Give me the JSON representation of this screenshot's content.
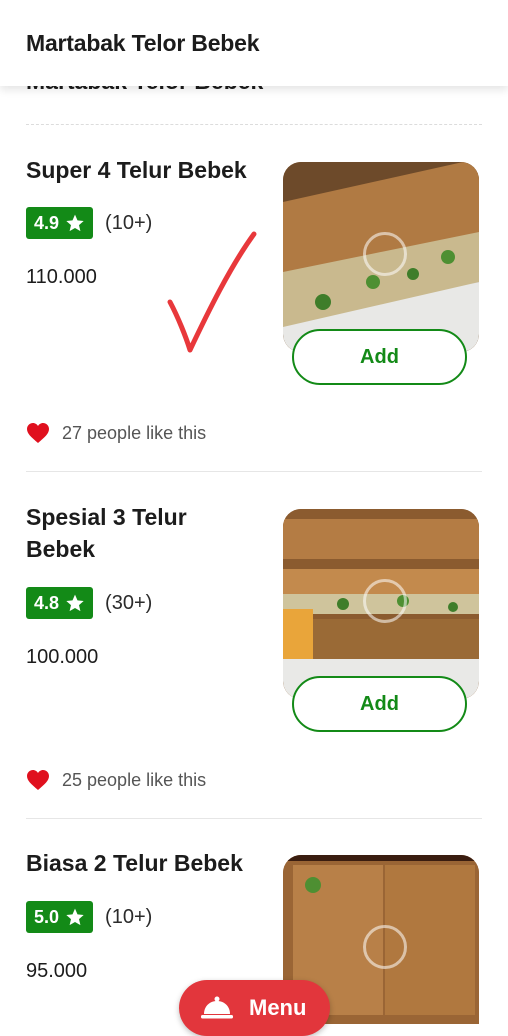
{
  "header": {
    "title": "Martabak Telor Bebek"
  },
  "section": {
    "heading": "Martabak Telor Bebek"
  },
  "colors": {
    "rating_green": "#138a17",
    "heart_red": "#e0101e",
    "menu_red": "#e2363c"
  },
  "items": [
    {
      "name": "Super 4 Telur Bebek",
      "rating": "4.9",
      "count": "(10+)",
      "price": "110.000",
      "add_label": "Add",
      "likes": "27 people like this"
    },
    {
      "name": "Spesial 3 Telur Bebek",
      "rating": "4.8",
      "count": "(30+)",
      "price": "100.000",
      "add_label": "Add",
      "likes": "25 people like this"
    },
    {
      "name": "Biasa 2 Telur Bebek",
      "rating": "5.0",
      "count": "(10+)",
      "price": "95.000"
    }
  ],
  "menu_button": {
    "label": "Menu",
    "icon": "cloche-icon"
  }
}
